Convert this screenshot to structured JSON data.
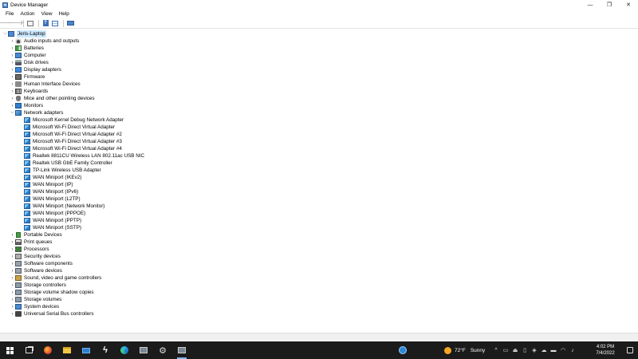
{
  "window": {
    "title": "Device Manager",
    "controls": {
      "minimize": "—",
      "maximize": "❐",
      "close": "✕"
    }
  },
  "menu": [
    "File",
    "Action",
    "View",
    "Help"
  ],
  "toolbar": {
    "back": "back-arrow-icon",
    "forward": "forward-arrow-icon",
    "properties": "properties-icon",
    "help": "?",
    "view": "view-icon",
    "monitor": "monitor-icon"
  },
  "tree": {
    "root": "Jeris-Laptop",
    "categories_before": [
      {
        "label": "Audio inputs and outputs",
        "icon": "audio"
      },
      {
        "label": "Batteries",
        "icon": "battery"
      },
      {
        "label": "Computer",
        "icon": "computer"
      },
      {
        "label": "Disk drives",
        "icon": "disk"
      },
      {
        "label": "Display adapters",
        "icon": "display"
      },
      {
        "label": "Firmware",
        "icon": "firmware"
      },
      {
        "label": "Human Interface Devices",
        "icon": "hid"
      },
      {
        "label": "Keyboards",
        "icon": "keyboard"
      },
      {
        "label": "Mice and other pointing devices",
        "icon": "mouse"
      },
      {
        "label": "Monitors",
        "icon": "monitor"
      }
    ],
    "expanded": {
      "label": "Network adapters",
      "children": [
        "Microsoft Kernel Debug Network Adapter",
        "Microsoft Wi-Fi Direct Virtual Adapter",
        "Microsoft Wi-Fi Direct Virtual Adapter #2",
        "Microsoft Wi-Fi Direct Virtual Adapter #3",
        "Microsoft Wi-Fi Direct Virtual Adapter #4",
        "Realtek 8811CU Wireless LAN 802.11ac USB NIC",
        "Realtek USB GbE Family Controller",
        "TP-Link Wireless USB Adapter",
        "WAN Miniport (IKEv2)",
        "WAN Miniport (IP)",
        "WAN Miniport (IPv6)",
        "WAN Miniport (L2TP)",
        "WAN Miniport (Network Monitor)",
        "WAN Miniport (PPPOE)",
        "WAN Miniport (PPTP)",
        "WAN Miniport (SSTP)"
      ]
    },
    "categories_after": [
      {
        "label": "Portable Devices",
        "icon": "portable"
      },
      {
        "label": "Print queues",
        "icon": "print"
      },
      {
        "label": "Processors",
        "icon": "processor"
      },
      {
        "label": "Security devices",
        "icon": "security"
      },
      {
        "label": "Software components",
        "icon": "software"
      },
      {
        "label": "Software devices",
        "icon": "software"
      },
      {
        "label": "Sound, video and game controllers",
        "icon": "sound"
      },
      {
        "label": "Storage controllers",
        "icon": "storage"
      },
      {
        "label": "Storage volume shadow copies",
        "icon": "storage"
      },
      {
        "label": "Storage volumes",
        "icon": "storage"
      },
      {
        "label": "System devices",
        "icon": "system"
      },
      {
        "label": "Universal Serial Bus controllers",
        "icon": "usb"
      }
    ]
  },
  "taskbar": {
    "apps": [
      "start",
      "task-view",
      "firefox",
      "file-explorer",
      "mail",
      "lightning",
      "edge",
      "device-manager-app",
      "settings",
      "device-manager"
    ],
    "weather": {
      "temp": "72°F",
      "condition": "Sunny"
    },
    "clock": {
      "time": "4:02 PM",
      "date": "7/4/2022"
    }
  }
}
